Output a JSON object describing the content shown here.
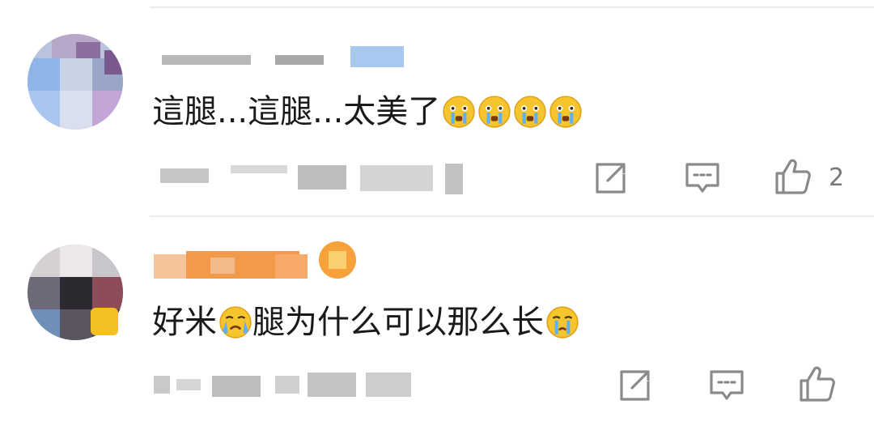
{
  "comments": [
    {
      "text_prefix": "這腿...這腿...太美了",
      "emoji": [
        "crying-emoji",
        "crying-emoji",
        "crying-emoji",
        "crying-emoji"
      ],
      "like_count": "2"
    },
    {
      "text_prefix": "好米",
      "emoji_mid": "crying-emoji",
      "text_suffix": "腿为什么可以那么长",
      "emoji_end": "crying-emoji",
      "like_count": ""
    }
  ],
  "colors": {
    "text": "#1a1a1a",
    "secondary": "#777777",
    "icon": "#8a8a8a",
    "divider": "#ececec",
    "badge_blue": "#a8c8f0",
    "nickname_orange": "#f39a4a"
  }
}
